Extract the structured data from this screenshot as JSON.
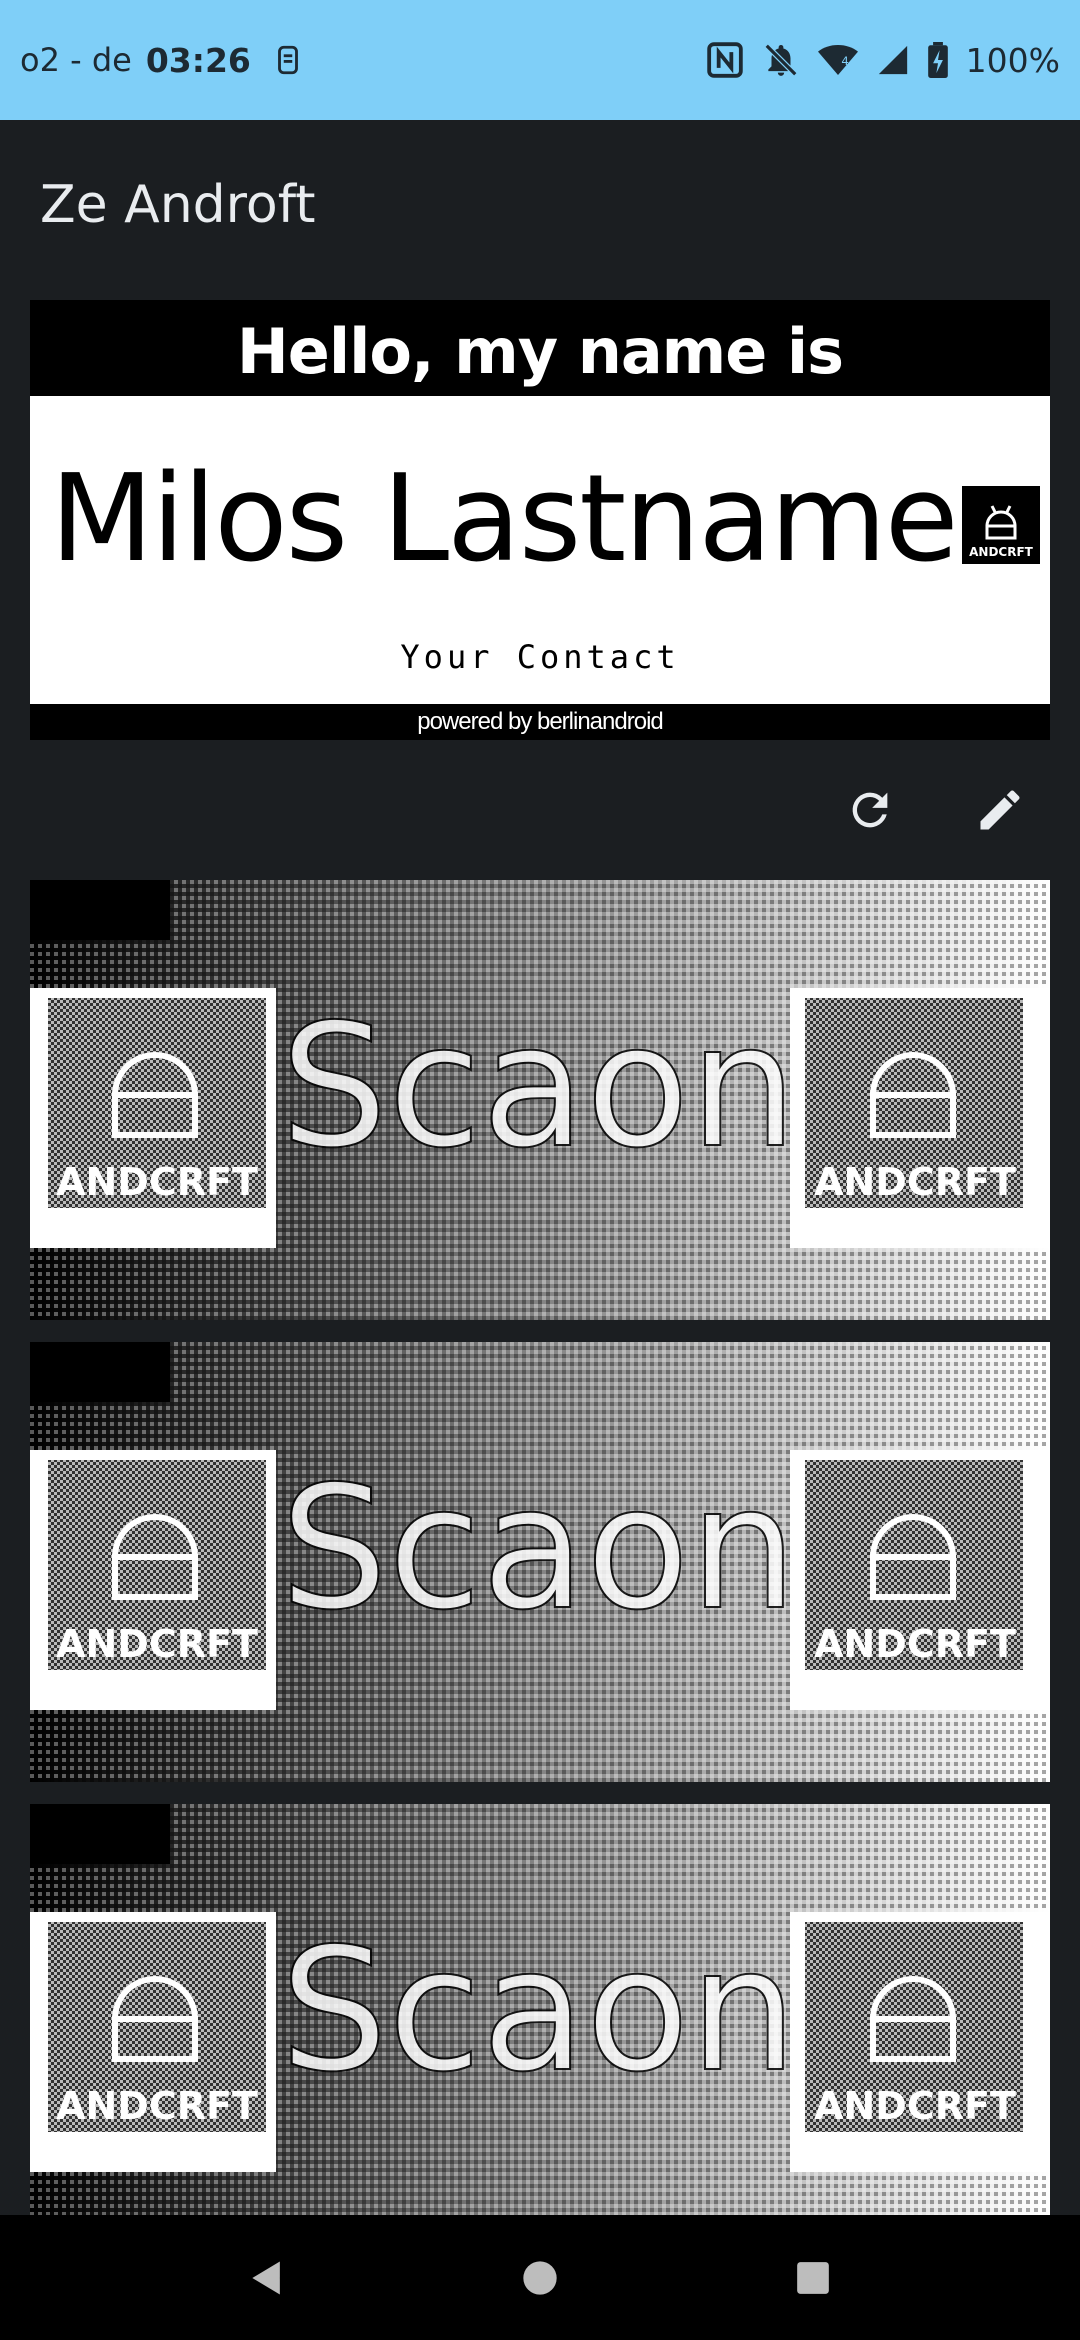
{
  "status_bar": {
    "carrier": "o2 - de",
    "time": "03:26",
    "battery": "100%",
    "icons": [
      "vpn-icon",
      "nfc-icon",
      "mute-icon",
      "wifi-icon",
      "signal-icon",
      "battery-icon"
    ]
  },
  "app": {
    "title": "Ze Androft"
  },
  "badge": {
    "header": "Hello, my name is",
    "name": "Milos Lastname",
    "contact": "Your Contact",
    "footer": "powered by berlinandroid",
    "logo_text": "ANDCRFT"
  },
  "actions": {
    "icons": [
      "refresh-icon",
      "edit-icon"
    ]
  },
  "images": [
    {
      "text": "Scaon",
      "logo_text": "ANDCRFT"
    },
    {
      "text": "Scaon",
      "logo_text": "ANDCRFT"
    },
    {
      "text": "Scaon",
      "logo_text": "ANDCRFT"
    }
  ],
  "nav": {
    "icons": [
      "back-icon",
      "home-icon",
      "recents-icon"
    ]
  },
  "colors": {
    "status_bar": "#7fcff8",
    "background": "#1b1e21",
    "nav_bar": "#000000"
  }
}
